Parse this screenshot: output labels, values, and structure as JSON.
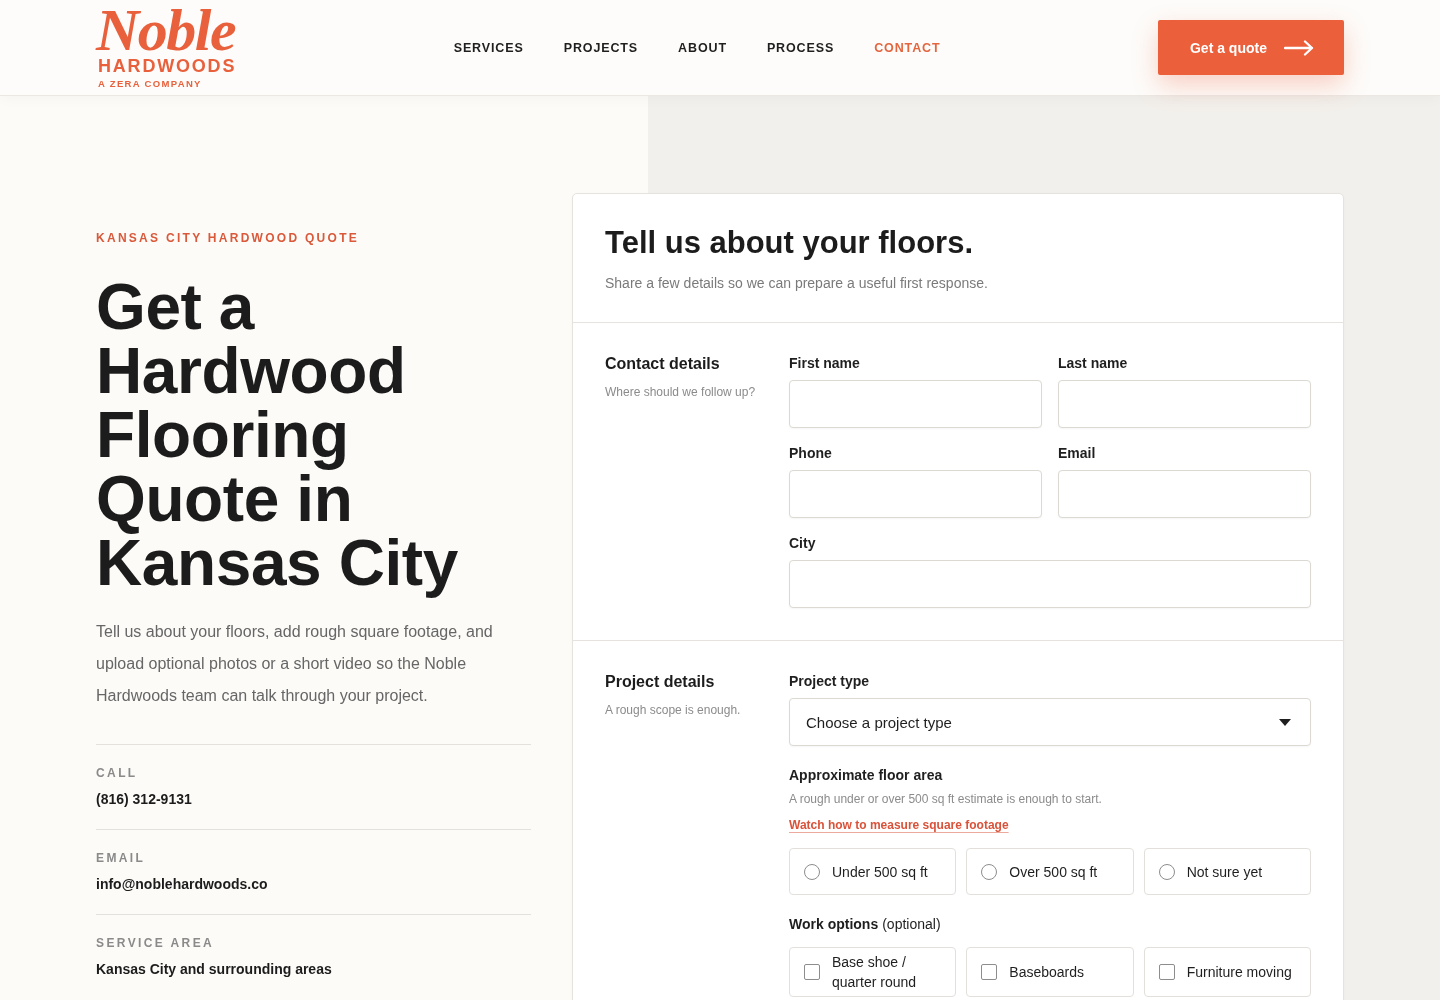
{
  "header": {
    "logo": {
      "wordmark": "Noble",
      "name": "HARDWOODS",
      "tagline": "A ZERA COMPANY"
    },
    "nav": [
      {
        "label": "SERVICES",
        "selected": false
      },
      {
        "label": "PROJECTS",
        "selected": false
      },
      {
        "label": "ABOUT",
        "selected": false
      },
      {
        "label": "PROCESS",
        "selected": false
      },
      {
        "label": "CONTACT",
        "selected": true
      }
    ],
    "cta": {
      "label": "Get a quote"
    }
  },
  "intro": {
    "eyebrow": "KANSAS CITY HARDWOOD QUOTE",
    "title": "Get a Hardwood Flooring Quote in Kansas City",
    "body": "Tell us about your floors, add rough square footage, and upload optional photos or a short video so the Noble Hardwoods team can talk through your project.",
    "contacts": [
      {
        "label": "CALL",
        "value": "(816) 312-9131"
      },
      {
        "label": "EMAIL",
        "value": "info@noblehardwoods.co"
      },
      {
        "label": "SERVICE AREA",
        "value": "Kansas City and surrounding areas"
      }
    ]
  },
  "form": {
    "title": "Tell us about your floors.",
    "subtitle": "Share a few details so we can prepare a useful first response.",
    "sections": [
      {
        "title": "Contact details",
        "hint": "Where should we follow up?",
        "rows": [
          [
            {
              "kind": "text",
              "label": "First name"
            },
            {
              "kind": "text",
              "label": "Last name"
            }
          ],
          [
            {
              "kind": "text",
              "label": "Phone"
            },
            {
              "kind": "text",
              "label": "Email"
            }
          ],
          [
            {
              "kind": "text",
              "label": "City"
            }
          ]
        ]
      },
      {
        "title": "Project details",
        "hint": "A rough scope is enough.",
        "rows": [
          [
            {
              "kind": "select",
              "label": "Project type",
              "value": "Choose a project type"
            }
          ],
          [
            {
              "kind": "radio",
              "label": "Approximate floor area",
              "hint": "A rough under or over 500 sq ft estimate is enough to start.",
              "link": "Watch how to measure square footage",
              "options": [
                {
                  "label": "Under 500 sq ft",
                  "selected": false
                },
                {
                  "label": "Over 500 sq ft",
                  "selected": false
                },
                {
                  "label": "Not sure yet",
                  "selected": false
                }
              ]
            }
          ],
          [
            {
              "kind": "checkbox",
              "label": "Work options",
              "note": "(optional)",
              "options": [
                {
                  "label": "Base shoe / quarter round",
                  "checked": false
                },
                {
                  "label": "Baseboards",
                  "checked": false
                },
                {
                  "label": "Furniture moving",
                  "checked": false
                }
              ]
            }
          ]
        ]
      }
    ]
  }
}
